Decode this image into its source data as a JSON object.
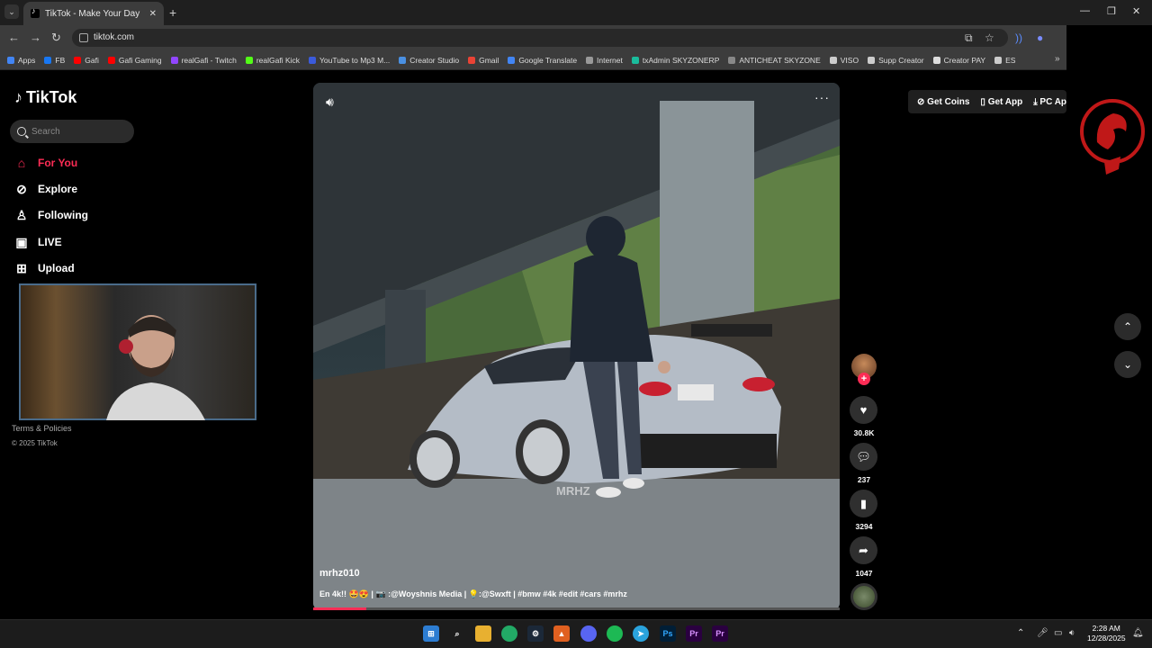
{
  "browser": {
    "tab_title": "TikTok - Make Your Day",
    "url": "tiktok.com",
    "bookmarks": [
      "Apps",
      "FB",
      "Gafi",
      "Gafi Gaming",
      "realGafi - Twitch",
      "realGafi Kick",
      "YouTube to Mp3 M...",
      "Creator Studio",
      "Gmail",
      "Google Translate",
      "Internet",
      "txAdmin SKYZONERP",
      "ANTICHEAT SKYZONE",
      "VISO",
      "Supp Creator",
      "Creator PAY",
      "ES"
    ],
    "bookmark_colors": [
      "#4285f4",
      "#1877f2",
      "#ff0000",
      "#ff0000",
      "#9146ff",
      "#53fc18",
      "#3b5bdb",
      "#4a90e2",
      "#ea4335",
      "#4285f4",
      "#999999",
      "#1abc9c",
      "#888888",
      "#cccccc",
      "#cccccc",
      "#dddddd",
      "#cccccc"
    ]
  },
  "sidebar": {
    "logo": "TikTok",
    "search_placeholder": "Search",
    "nav": {
      "for_you": "For You",
      "explore": "Explore",
      "following": "Following",
      "live": "LIVE",
      "upload": "Upload"
    },
    "footer": {
      "terms": "Terms & Policies",
      "copyright": "© 2025 TikTok"
    }
  },
  "video": {
    "author": "mrhz010",
    "caption": "En 4k!! 🤩😍 | 📷 :@Woyshnis Media | 💡:@Swxft | #bmw #4k #edit #cars #mrhz",
    "watermark": "MRHZ",
    "progress_fraction": 0.1
  },
  "actions": {
    "likes": "30.8K",
    "comments": "237",
    "saves": "3294",
    "shares": "1047"
  },
  "topbar": {
    "get_coins": "Get Coins",
    "get_app": "Get App",
    "pc_app": "PC Ap"
  },
  "taskbar": {
    "time": "2:28 AM",
    "date": "12/28/2025"
  },
  "colors": {
    "accent": "#fe2c55"
  }
}
